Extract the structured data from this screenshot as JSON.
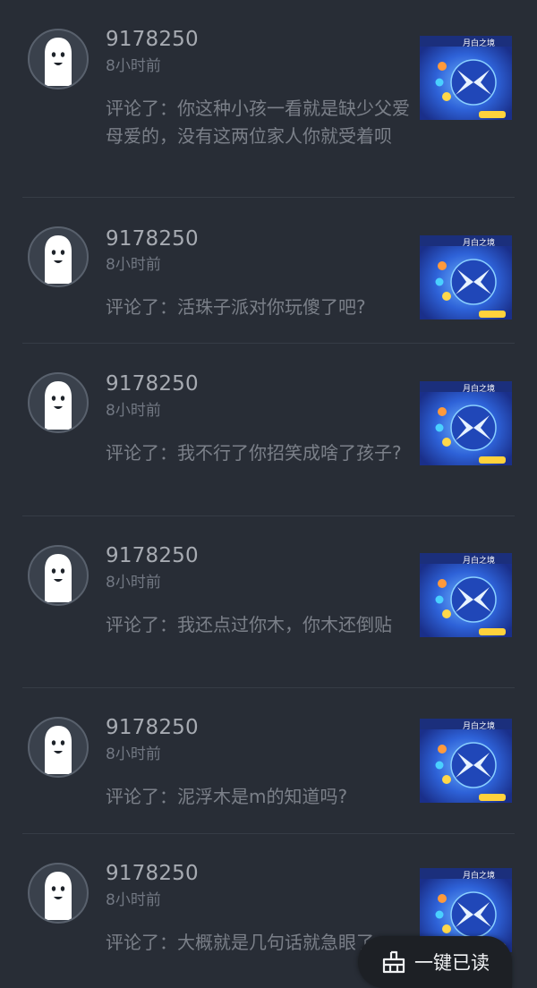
{
  "notifications": [
    {
      "username": "9178250",
      "time": "8小时前",
      "comment": "评论了：你这种小孩一看就是缺少父爱母爱的，没有这两位家人你就受着呗",
      "thumbnail_icon": "game-screenshot"
    },
    {
      "username": "9178250",
      "time": "8小时前",
      "comment": "评论了：活珠子派对你玩傻了吧?",
      "thumbnail_icon": "game-screenshot"
    },
    {
      "username": "9178250",
      "time": "8小时前",
      "comment": "评论了：我不行了你招笑成啥了孩子?",
      "thumbnail_icon": "game-screenshot"
    },
    {
      "username": "9178250",
      "time": "8小时前",
      "comment": "评论了：我还点过你木，你木还倒贴",
      "thumbnail_icon": "game-screenshot"
    },
    {
      "username": "9178250",
      "time": "8小时前",
      "comment": "评论了：泥浮木是m的知道吗?",
      "thumbnail_icon": "game-screenshot"
    },
    {
      "username": "9178250",
      "time": "8小时前",
      "comment": "评论了：大概就是几句话就急眼了",
      "thumbnail_icon": "game-screenshot"
    }
  ],
  "read_all_button": {
    "label": "一键已读",
    "icon": "broom-icon"
  },
  "colors": {
    "background": "#282d36",
    "username": "#a7abb2",
    "time": "#727883",
    "comment": "#7b8089",
    "thumbnail_blue": "#2a56c8"
  }
}
